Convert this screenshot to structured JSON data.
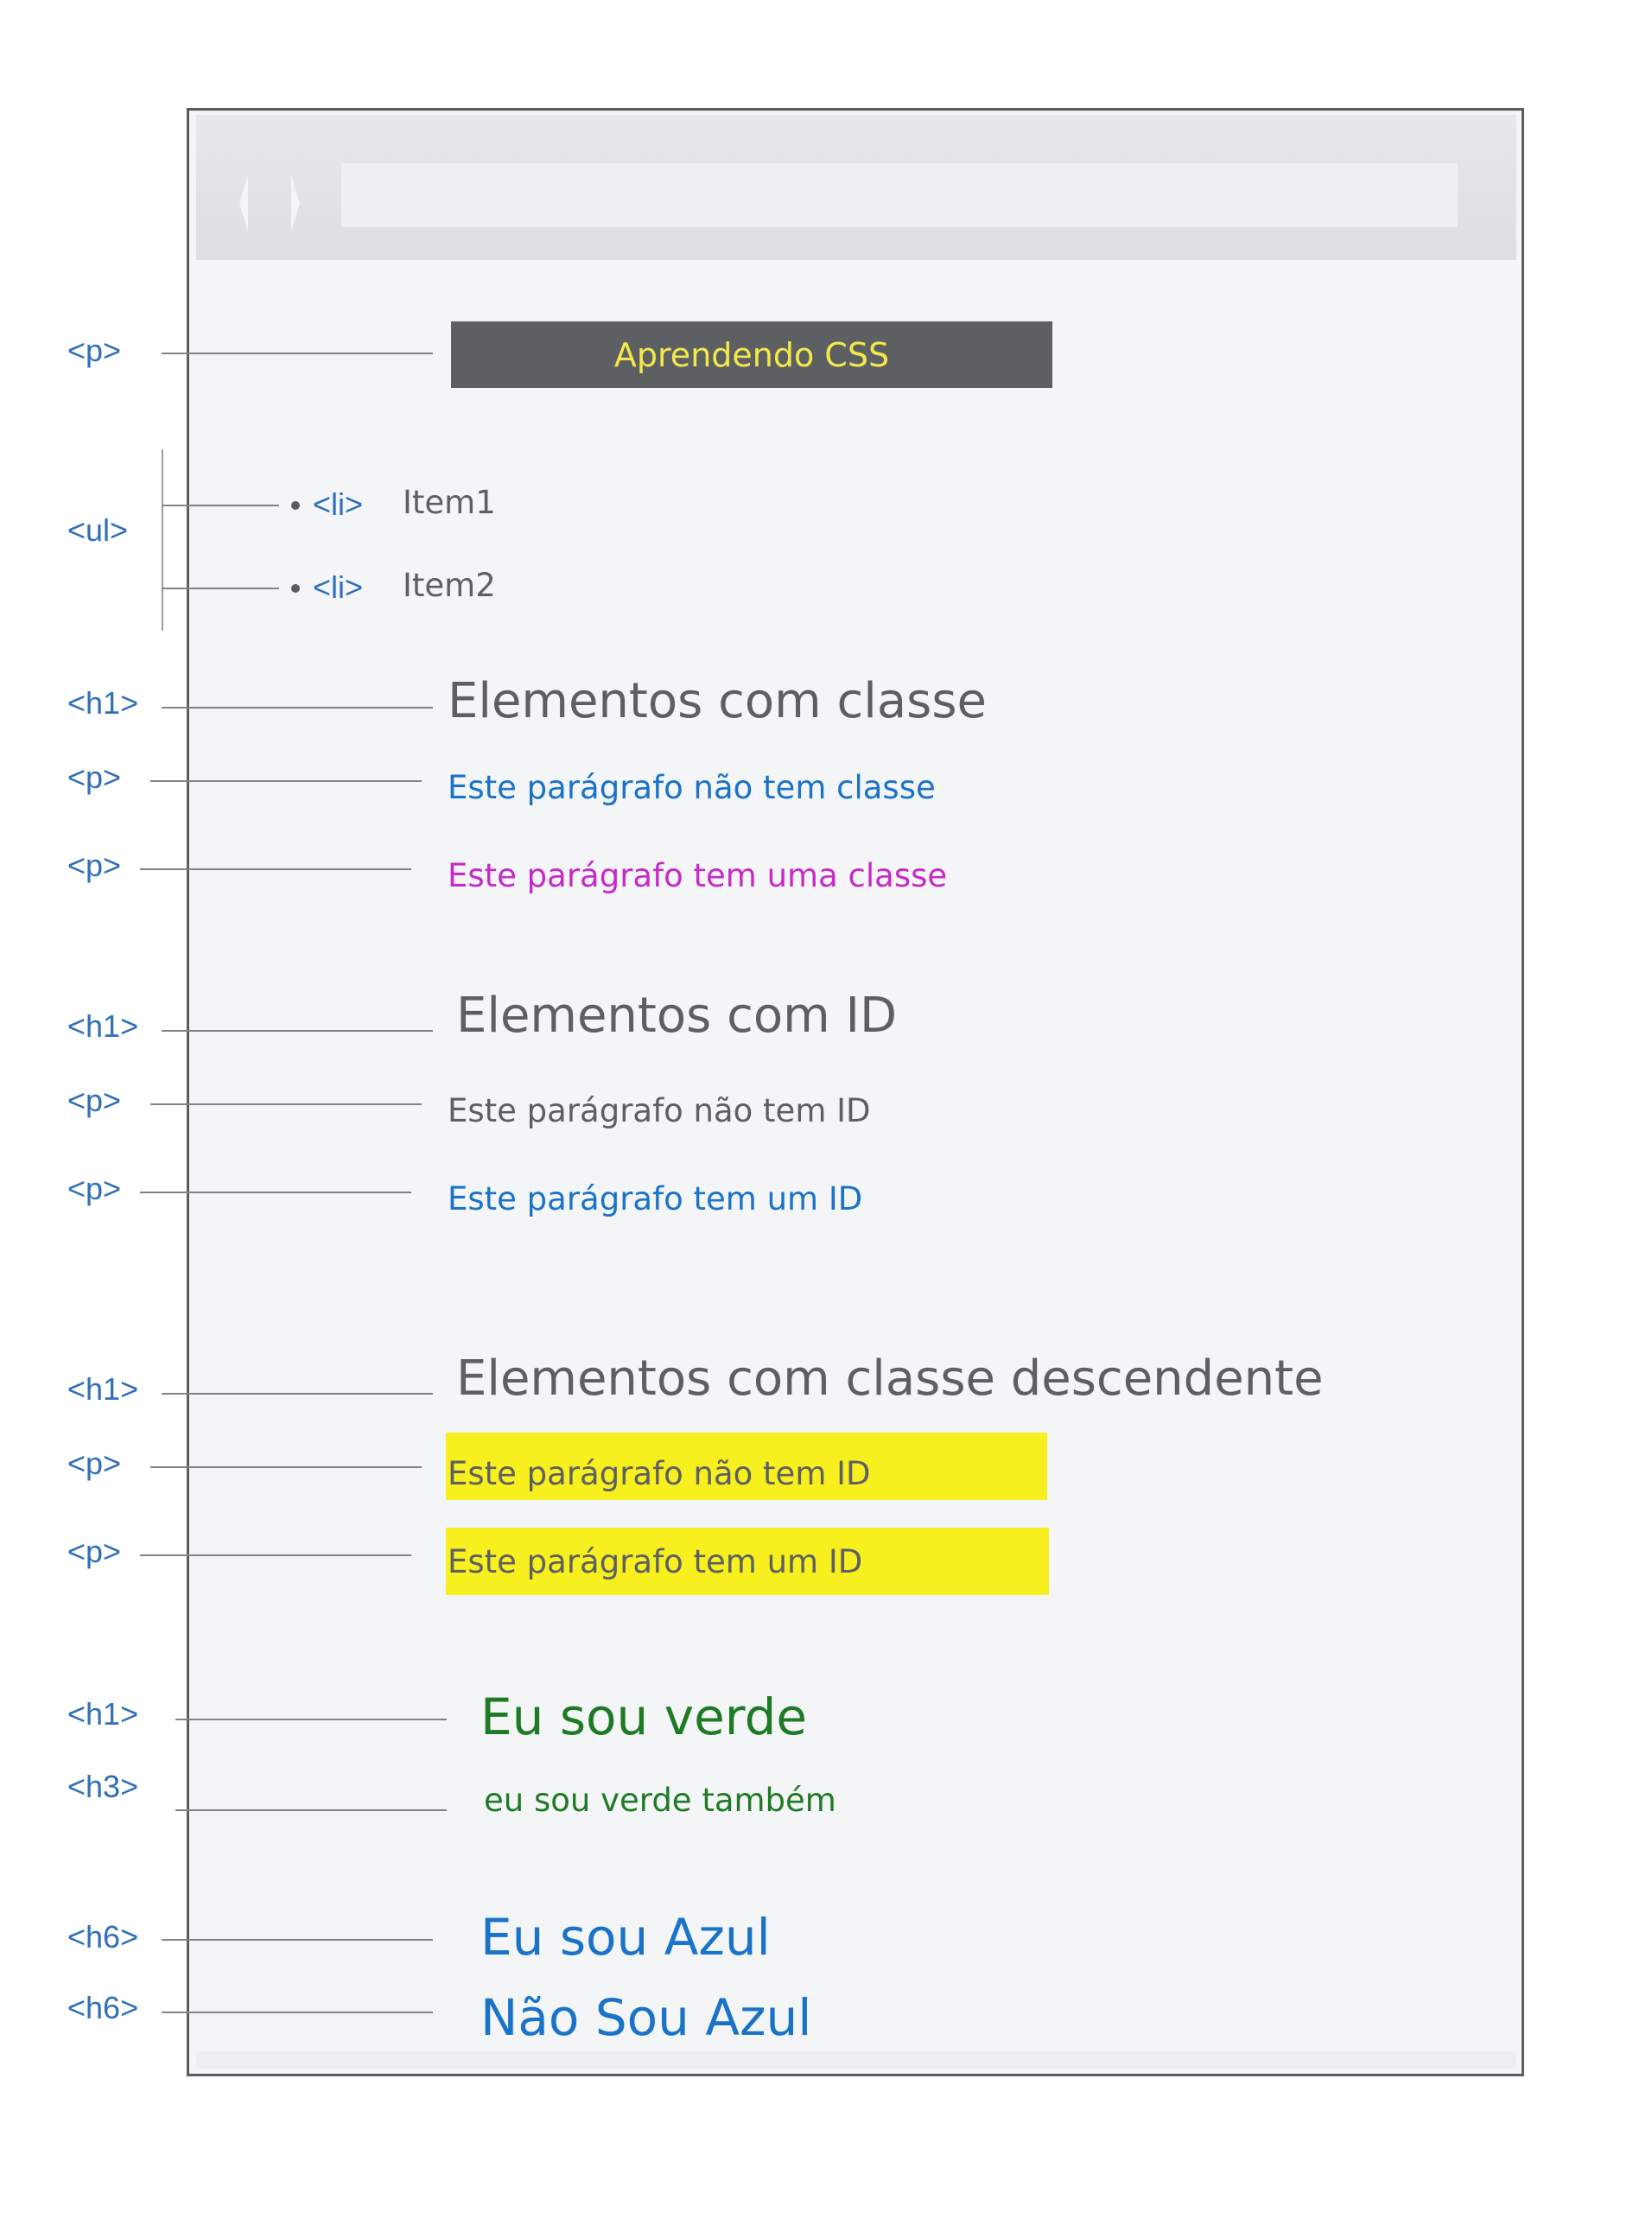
{
  "tags": {
    "p_banner": "<p>",
    "ul": "<ul>",
    "li_1": "<li>",
    "li_2": "<li>",
    "h1_classe": "<h1>",
    "p_classe_1": "<p>",
    "p_classe_2": "<p>",
    "h1_id": "<h1>",
    "p_id_1": "<p>",
    "p_id_2": "<p>",
    "h1_desc": "<h1>",
    "p_desc_1": "<p>",
    "p_desc_2": "<p>",
    "h1_verde": "<h1>",
    "h3_verde": "<h3>",
    "h6_azul": "<h6>",
    "h6_nao_azul": "<h6>"
  },
  "content": {
    "banner": "Aprendendo CSS",
    "list_items": [
      "Item1",
      "Item2"
    ],
    "section_classe": {
      "heading": "Elementos com classe",
      "p1": "Este parágrafo não tem classe",
      "p2": "Este parágrafo tem uma classe"
    },
    "section_id": {
      "heading": "Elementos com ID",
      "p1": "Este parágrafo não tem ID",
      "p2": "Este parágrafo tem um ID"
    },
    "section_descendente": {
      "heading": "Elementos com classe descendente",
      "p1": "Este parágrafo não tem ID",
      "p2": "Este parágrafo tem um ID"
    },
    "verde": {
      "h1": "Eu sou verde",
      "h3": "eu sou verde também"
    },
    "azul": {
      "h6_1": "Eu sou Azul",
      "h6_2": "Não Sou Azul"
    }
  },
  "colors": {
    "tag_blue": "#2f6fb8",
    "gray_text": "#5d6063",
    "blue_text": "#1a73c8",
    "magenta_text": "#c62ac8",
    "green_text": "#1e7a24",
    "yellow_highlight": "#f7f01e",
    "banner_bg": "#5d6063",
    "banner_text": "#f5e84a"
  },
  "icons": [
    "back-arrow-icon",
    "forward-arrow-icon"
  ]
}
